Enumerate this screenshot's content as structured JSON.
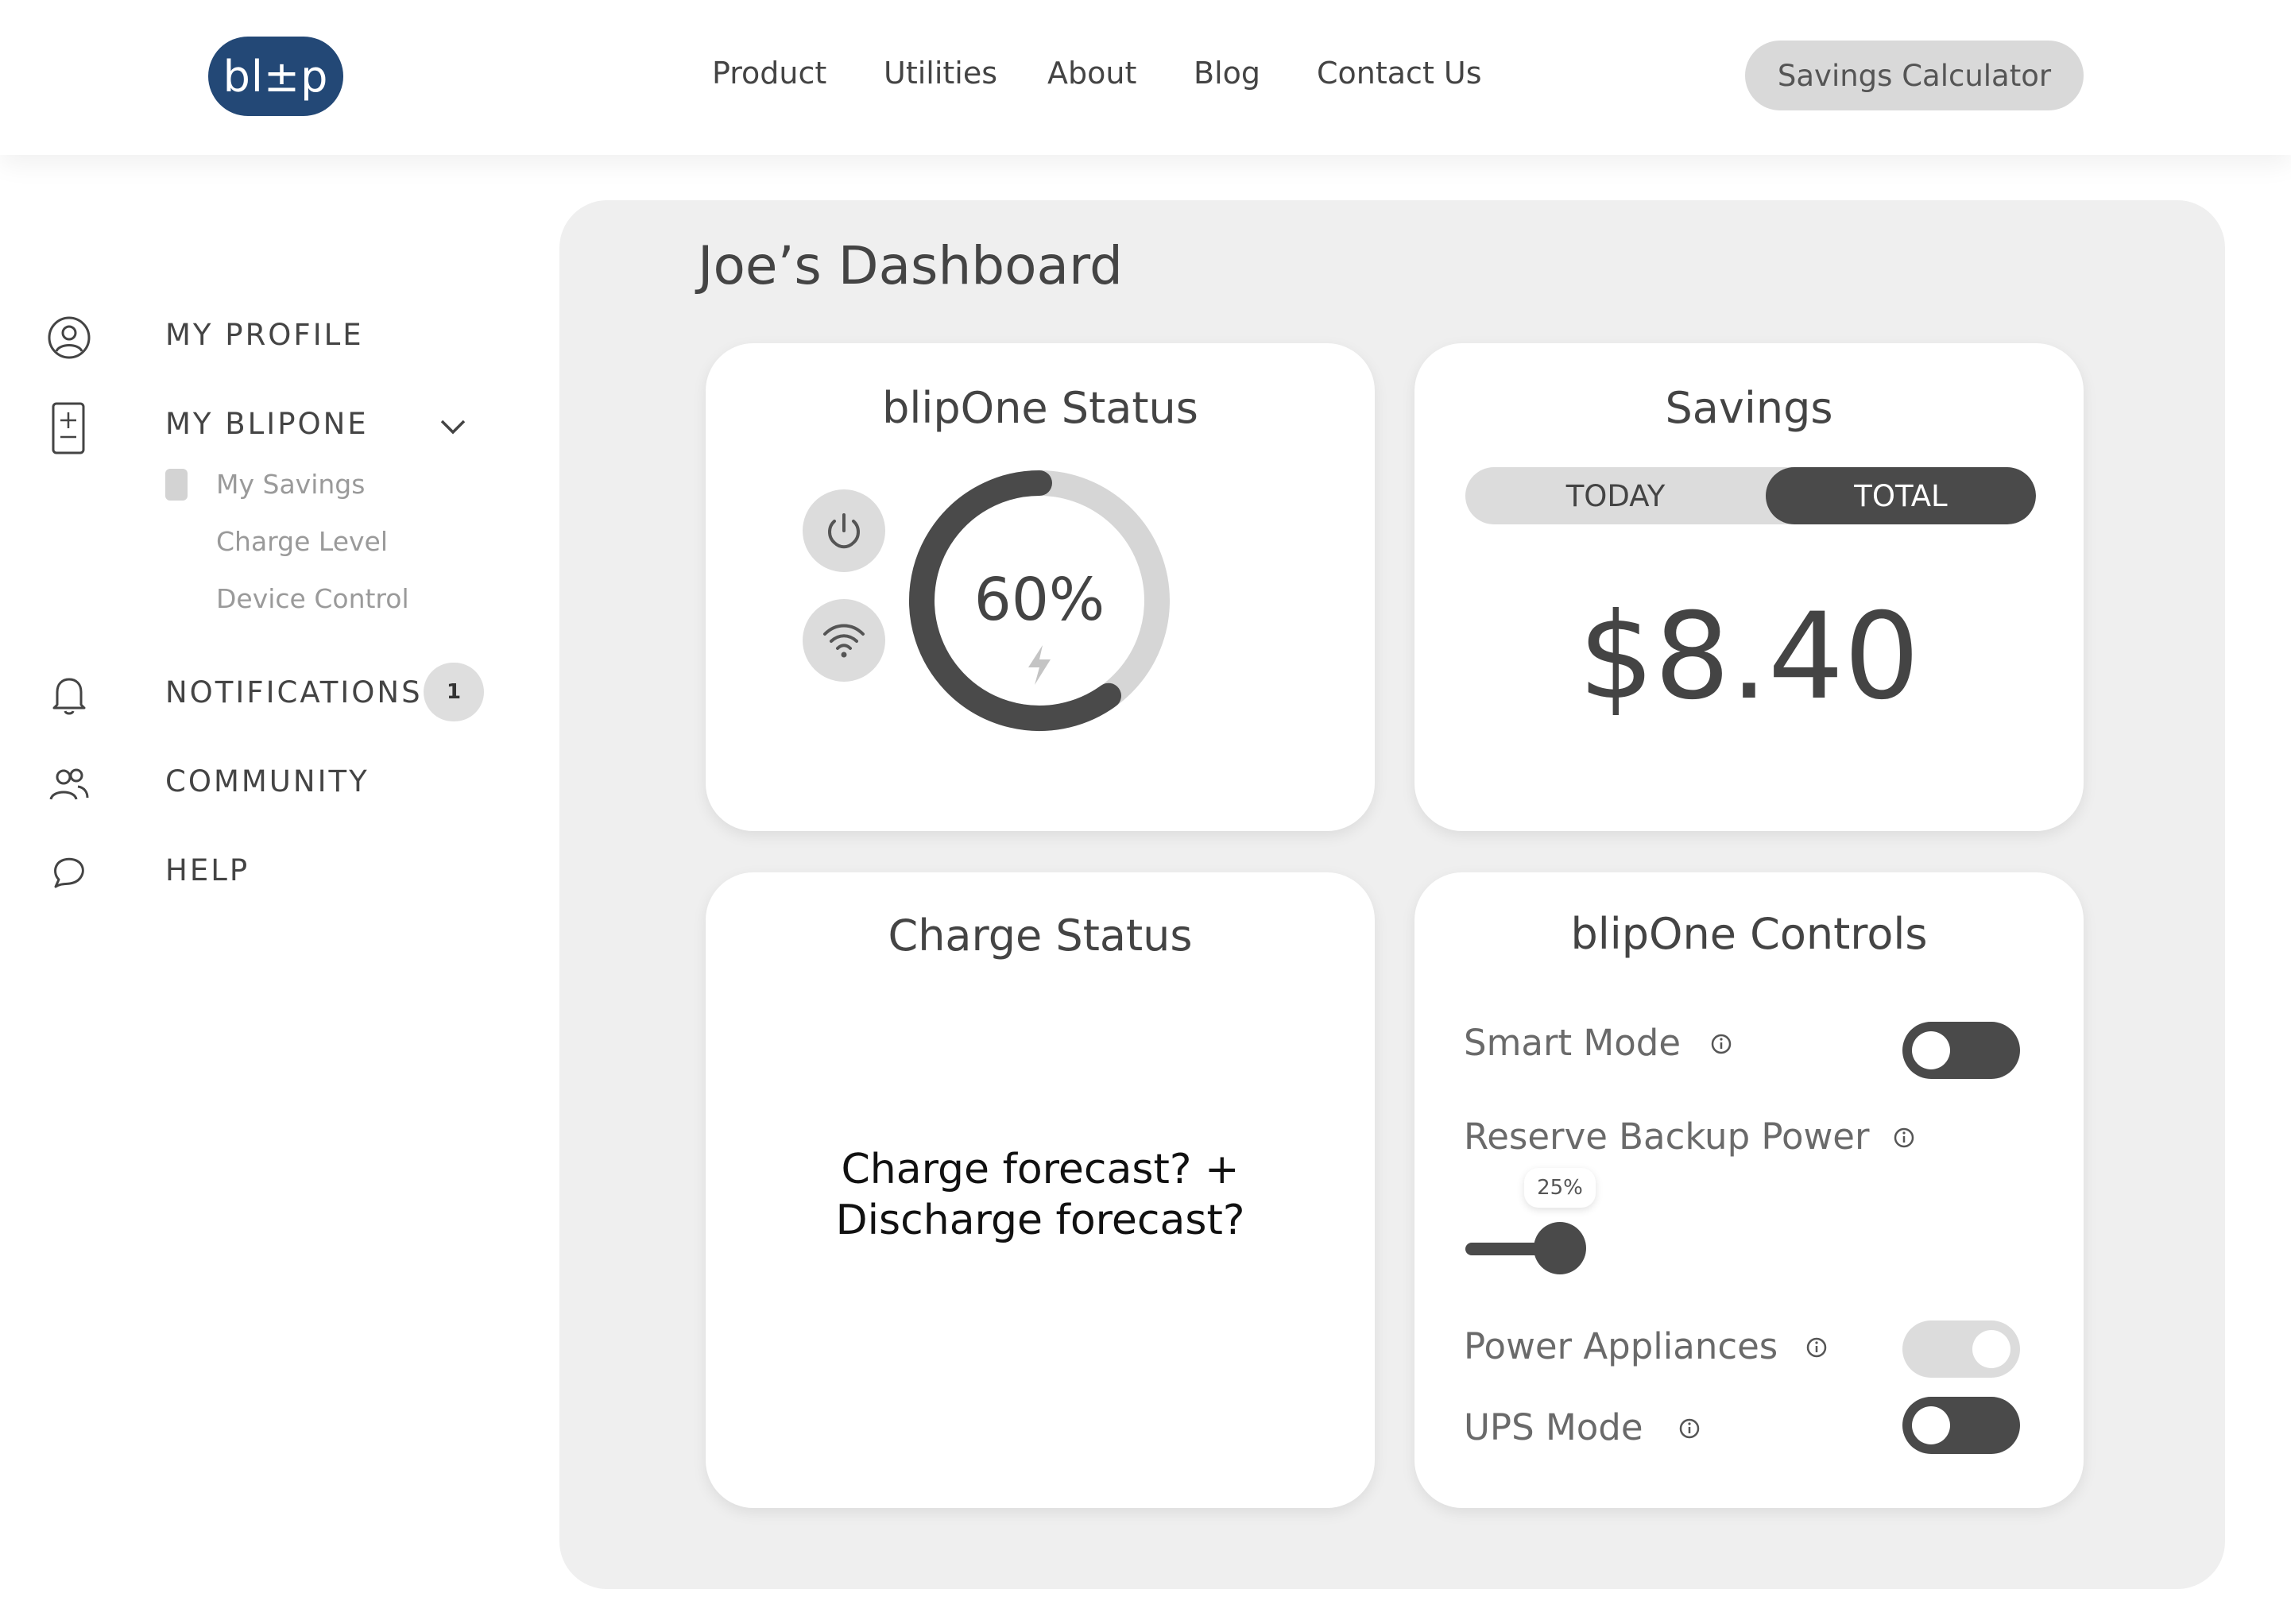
{
  "header": {
    "logo_text": "bl±p",
    "nav": [
      "Product",
      "Utilities",
      "About",
      "Blog",
      "Contact Us"
    ],
    "cta_label": "Savings Calculator"
  },
  "sidebar": {
    "my_profile": "MY PROFILE",
    "my_blipone": "MY BLIPONE",
    "sub_items": [
      "My Savings",
      "Charge Level",
      "Device Control"
    ],
    "notifications": "NOTIFICATIONS",
    "notifications_count": "1",
    "community": "COMMUNITY",
    "help": "HELP"
  },
  "dashboard": {
    "title": "Joe’s Dashboard",
    "status_card": {
      "title": "blipOne Status",
      "charge_percent": "60%",
      "charge_fraction": 0.6
    },
    "savings_card": {
      "title": "Savings",
      "tab_today": "TODAY",
      "tab_total": "TOTAL",
      "selected_tab": "TOTAL",
      "amount": "$8.40"
    },
    "charge_card": {
      "title": "Charge Status",
      "line1": "Charge forecast? +",
      "line2": "Discharge forecast?"
    },
    "controls_card": {
      "title": "blipOne Controls",
      "smart_mode": "Smart Mode",
      "reserve_backup": "Reserve Backup Power",
      "reserve_value": "25%",
      "reserve_fraction": 0.25,
      "power_appliances": "Power Appliances",
      "ups_mode": "UPS Mode"
    }
  },
  "colors": {
    "brand": "#234876",
    "dark": "#444444",
    "panel": "#efefef",
    "toggle_light": "#dcdcdc"
  }
}
